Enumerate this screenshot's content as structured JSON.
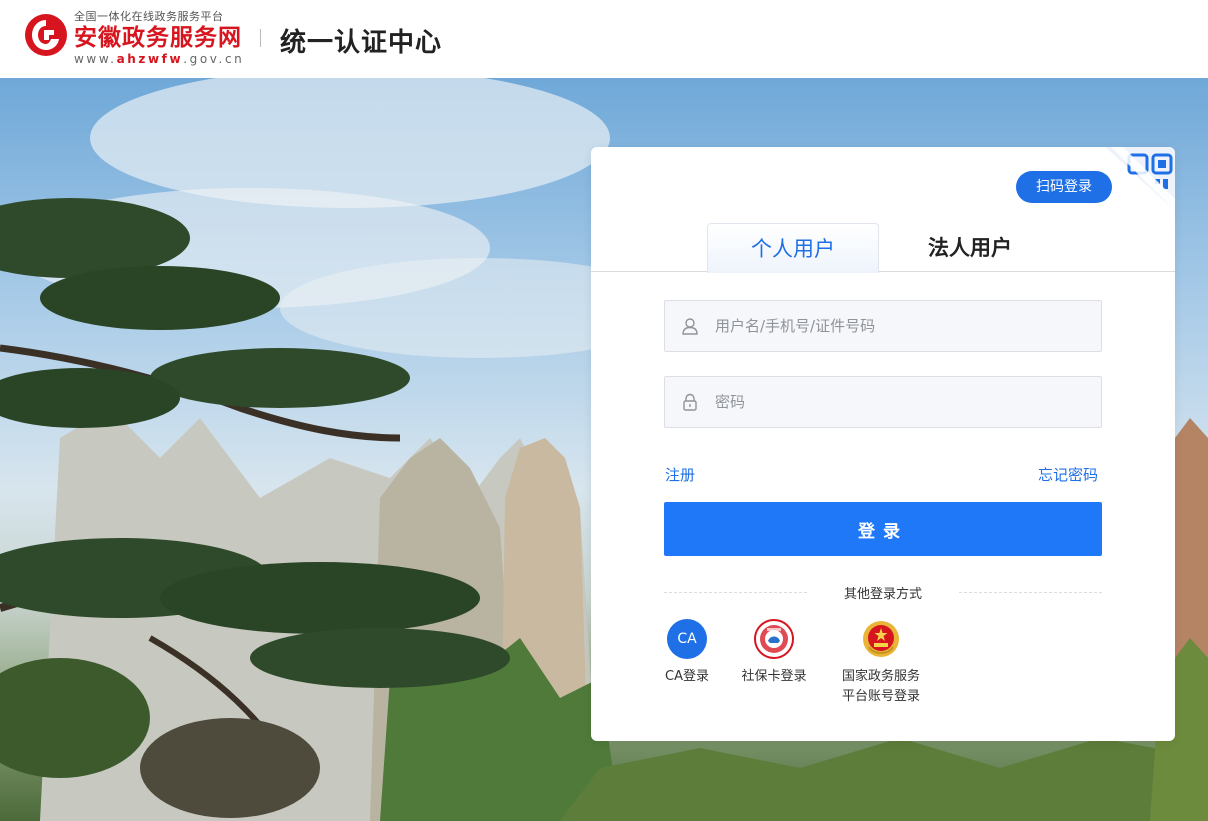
{
  "header": {
    "logo_sub": "全国一体化在线政务服务平台",
    "logo_main": "安徽政务服务网",
    "logo_url_prefix": "www.",
    "logo_url_brand": "ahzwfw",
    "logo_url_suffix": ".gov.cn",
    "title": "统一认证中心"
  },
  "login": {
    "qr_button": "扫码登录",
    "tabs": [
      {
        "label": "个人用户",
        "active": true
      },
      {
        "label": "法人用户",
        "active": false
      }
    ],
    "username_placeholder": "用户名/手机号/证件号码",
    "password_placeholder": "密码",
    "register_link": "注册",
    "forgot_link": "忘记密码",
    "submit_label": "登录",
    "other_title": "其他登录方式",
    "methods": [
      {
        "icon": "ca-icon",
        "icon_text": "CA",
        "label": "CA登录"
      },
      {
        "icon": "social-security-card-icon",
        "label": "社保卡登录"
      },
      {
        "icon": "national-emblem-icon",
        "label_line1": "国家政务服务",
        "label_line2": "平台账号登录"
      }
    ]
  },
  "colors": {
    "brand_red": "#d7151f",
    "accent_blue": "#1f6fe6",
    "button_blue": "#1f78f7"
  }
}
